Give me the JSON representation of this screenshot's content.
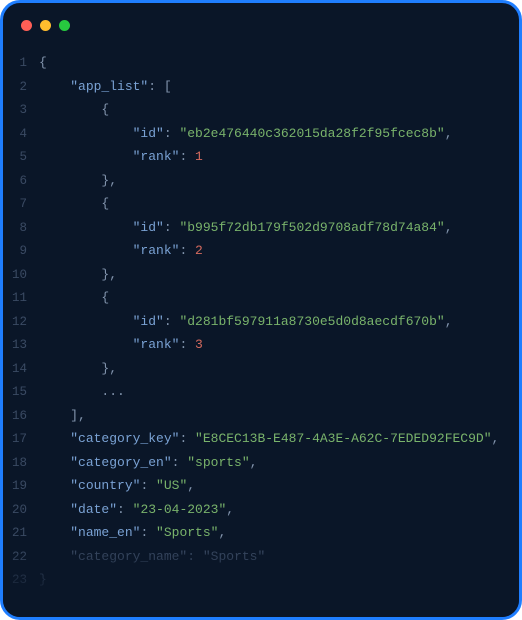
{
  "window": {
    "traffic_lights": [
      "close",
      "minimize",
      "maximize"
    ]
  },
  "code": {
    "lines": [
      {
        "n": 1,
        "ind": 0,
        "dim": false,
        "tokens": [
          {
            "t": "{",
            "c": "p"
          }
        ]
      },
      {
        "n": 2,
        "ind": 1,
        "dim": false,
        "tokens": [
          {
            "t": "\"app_list\"",
            "c": "k"
          },
          {
            "t": ": [",
            "c": "p"
          }
        ]
      },
      {
        "n": 3,
        "ind": 2,
        "dim": false,
        "tokens": [
          {
            "t": "{",
            "c": "p"
          }
        ]
      },
      {
        "n": 4,
        "ind": 3,
        "dim": false,
        "tokens": [
          {
            "t": "\"id\"",
            "c": "k"
          },
          {
            "t": ": ",
            "c": "p"
          },
          {
            "t": "\"eb2e476440c362015da28f2f95fcec8b\"",
            "c": "s"
          },
          {
            "t": ",",
            "c": "p"
          }
        ]
      },
      {
        "n": 5,
        "ind": 3,
        "dim": false,
        "tokens": [
          {
            "t": "\"rank\"",
            "c": "k"
          },
          {
            "t": ": ",
            "c": "p"
          },
          {
            "t": "1",
            "c": "n"
          }
        ]
      },
      {
        "n": 6,
        "ind": 2,
        "dim": false,
        "tokens": [
          {
            "t": "},",
            "c": "p"
          }
        ]
      },
      {
        "n": 7,
        "ind": 2,
        "dim": false,
        "tokens": [
          {
            "t": "{",
            "c": "p"
          }
        ]
      },
      {
        "n": 8,
        "ind": 3,
        "dim": false,
        "tokens": [
          {
            "t": "\"id\"",
            "c": "k"
          },
          {
            "t": ": ",
            "c": "p"
          },
          {
            "t": "\"b995f72db179f502d9708adf78d74a84\"",
            "c": "s"
          },
          {
            "t": ",",
            "c": "p"
          }
        ]
      },
      {
        "n": 9,
        "ind": 3,
        "dim": false,
        "tokens": [
          {
            "t": "\"rank\"",
            "c": "k"
          },
          {
            "t": ": ",
            "c": "p"
          },
          {
            "t": "2",
            "c": "n"
          }
        ]
      },
      {
        "n": 10,
        "ind": 2,
        "dim": false,
        "tokens": [
          {
            "t": "},",
            "c": "p"
          }
        ]
      },
      {
        "n": 11,
        "ind": 2,
        "dim": false,
        "tokens": [
          {
            "t": "{",
            "c": "p"
          }
        ]
      },
      {
        "n": 12,
        "ind": 3,
        "dim": false,
        "tokens": [
          {
            "t": "\"id\"",
            "c": "k"
          },
          {
            "t": ": ",
            "c": "p"
          },
          {
            "t": "\"d281bf597911a8730e5d0d8aecdf670b\"",
            "c": "s"
          },
          {
            "t": ",",
            "c": "p"
          }
        ]
      },
      {
        "n": 13,
        "ind": 3,
        "dim": false,
        "tokens": [
          {
            "t": "\"rank\"",
            "c": "k"
          },
          {
            "t": ": ",
            "c": "p"
          },
          {
            "t": "3",
            "c": "n"
          }
        ]
      },
      {
        "n": 14,
        "ind": 2,
        "dim": false,
        "tokens": [
          {
            "t": "},",
            "c": "p"
          }
        ]
      },
      {
        "n": 15,
        "ind": 2,
        "dim": false,
        "tokens": [
          {
            "t": "...",
            "c": "p"
          }
        ]
      },
      {
        "n": 16,
        "ind": 1,
        "dim": false,
        "tokens": [
          {
            "t": "],",
            "c": "p"
          }
        ]
      },
      {
        "n": 17,
        "ind": 1,
        "dim": false,
        "tokens": [
          {
            "t": "\"category_key\"",
            "c": "k"
          },
          {
            "t": ": ",
            "c": "p"
          },
          {
            "t": "\"E8CEC13B-E487-4A3E-A62C-7EDED92FEC9D\"",
            "c": "s"
          },
          {
            "t": ",",
            "c": "p"
          }
        ]
      },
      {
        "n": 18,
        "ind": 1,
        "dim": false,
        "tokens": [
          {
            "t": "\"category_en\"",
            "c": "k"
          },
          {
            "t": ": ",
            "c": "p"
          },
          {
            "t": "\"sports\"",
            "c": "s"
          },
          {
            "t": ",",
            "c": "p"
          }
        ]
      },
      {
        "n": 19,
        "ind": 1,
        "dim": false,
        "tokens": [
          {
            "t": "\"country\"",
            "c": "k"
          },
          {
            "t": ": ",
            "c": "p"
          },
          {
            "t": "\"US\"",
            "c": "s"
          },
          {
            "t": ",",
            "c": "p"
          }
        ]
      },
      {
        "n": 20,
        "ind": 1,
        "dim": false,
        "tokens": [
          {
            "t": "\"date\"",
            "c": "k"
          },
          {
            "t": ": ",
            "c": "p"
          },
          {
            "t": "\"23-04-2023\"",
            "c": "s"
          },
          {
            "t": ",",
            "c": "p"
          }
        ]
      },
      {
        "n": 21,
        "ind": 1,
        "dim": false,
        "tokens": [
          {
            "t": "\"name_en\"",
            "c": "k"
          },
          {
            "t": ": ",
            "c": "p"
          },
          {
            "t": "\"Sports\"",
            "c": "s"
          },
          {
            "t": ",",
            "c": "p"
          }
        ]
      },
      {
        "n": 22,
        "ind": 1,
        "dim": true,
        "tokens": [
          {
            "t": "\"category_name\"",
            "c": "k"
          },
          {
            "t": ": ",
            "c": "p"
          },
          {
            "t": "\"Sports\"",
            "c": "s"
          }
        ]
      },
      {
        "n": 23,
        "ind": 0,
        "dim": true,
        "tokens": [
          {
            "t": "}",
            "c": "p"
          }
        ]
      }
    ],
    "indent_unit": "    "
  }
}
